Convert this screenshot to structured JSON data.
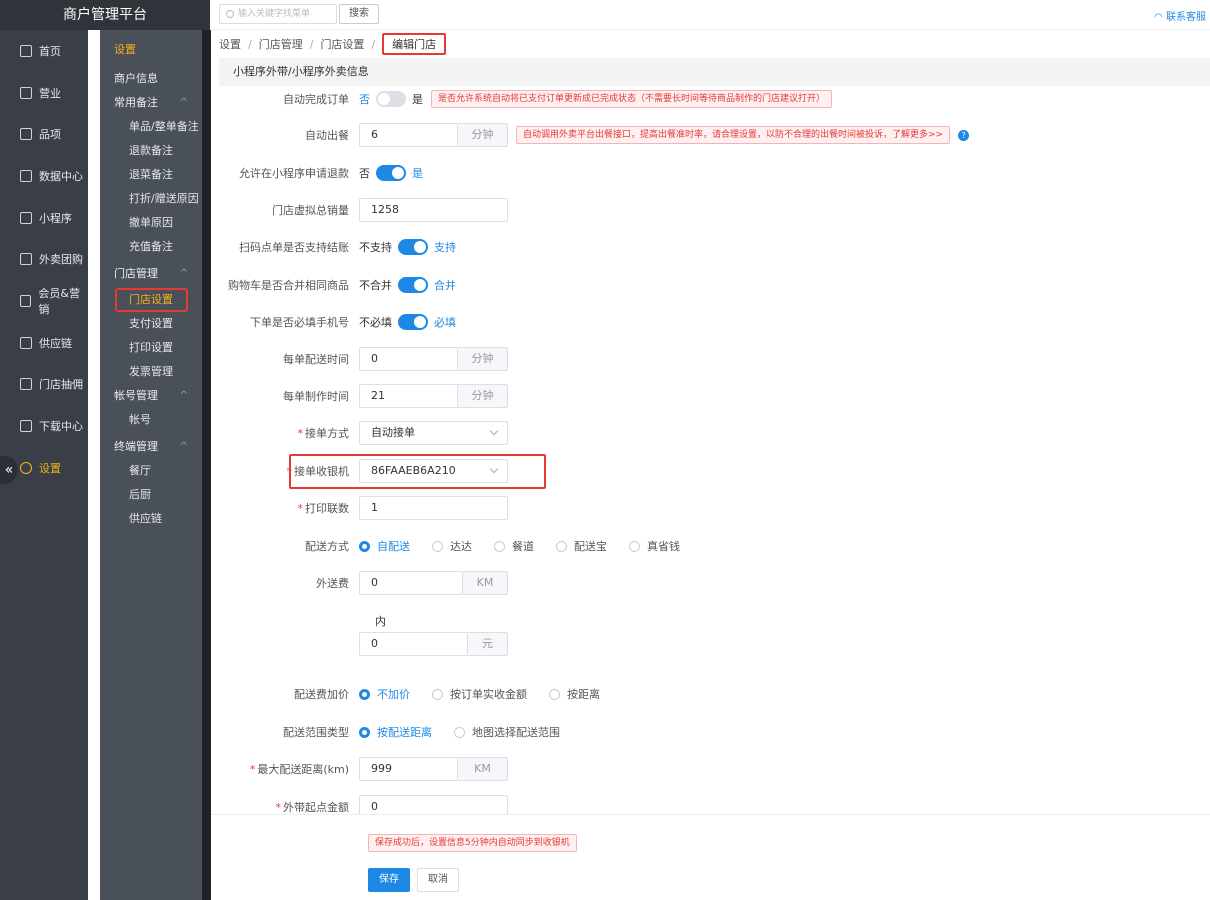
{
  "brand": "商户管理平台",
  "nav": [
    {
      "label": "首页",
      "icon": "home-icon"
    },
    {
      "label": "营业",
      "icon": "calendar-icon"
    },
    {
      "label": "品项",
      "icon": "bag-icon"
    },
    {
      "label": "数据中心",
      "icon": "share-icon"
    },
    {
      "label": "小程序",
      "icon": "phone-icon"
    },
    {
      "label": "外卖团购",
      "icon": "bike-icon"
    },
    {
      "label": "会员&营销",
      "icon": "user-icon"
    },
    {
      "label": "供应链",
      "icon": "truck-icon"
    },
    {
      "label": "门店抽佣",
      "icon": "database-icon"
    },
    {
      "label": "下载中心",
      "icon": "download-icon"
    },
    {
      "label": "设置",
      "icon": "gear-icon"
    }
  ],
  "collapse_glyph": "«",
  "subnav": {
    "title": "设置",
    "shop_info": "商户信息",
    "groups": [
      {
        "label": "常用备注",
        "items": [
          "单品/整单备注",
          "退款备注",
          "退菜备注",
          "打折/赠送原因",
          "撤单原因",
          "充值备注"
        ]
      },
      {
        "label": "门店管理",
        "items": [
          "门店设置",
          "支付设置",
          "打印设置",
          "发票管理"
        ]
      },
      {
        "label": "帐号管理",
        "items": [
          "帐号"
        ]
      },
      {
        "label": "终端管理",
        "items": [
          "餐厅",
          "后厨",
          "供应链"
        ]
      }
    ],
    "caret": "^"
  },
  "topbar": {
    "search_placeholder": "输入关键字找菜单",
    "search_button": "搜索",
    "contact": "联系客服"
  },
  "breadcrumb": [
    "设置",
    "门店管理",
    "门店设置",
    "编辑门店"
  ],
  "section_title": "小程序外带/小程序外卖信息",
  "form": {
    "auto_complete": {
      "label": "自动完成订单",
      "off": "否",
      "on": "是",
      "tip": "是否允许系统自动将已支付订单更新成已完成状态（不需要长时间等待商品制作的门店建议打开）"
    },
    "auto_out": {
      "label": "自动出餐",
      "value": "6",
      "unit": "分钟",
      "tip": "自动调用外卖平台出餐接口，提高出餐准时率，请合理设置，以防不合理的出餐时间被投诉，了解更多>>"
    },
    "allow_refund": {
      "label": "允许在小程序申请退款",
      "off": "否",
      "on": "是"
    },
    "virtual_sales": {
      "label": "门店虚拟总销量",
      "value": "1258"
    },
    "scan_checkout": {
      "label": "扫码点单是否支持结账",
      "off": "不支持",
      "on": "支持"
    },
    "cart_merge": {
      "label": "购物车是否合并相同商品",
      "off": "不合并",
      "on": "合并"
    },
    "phone_required": {
      "label": "下单是否必填手机号",
      "off": "不必填",
      "on": "必填"
    },
    "delivery_time": {
      "label": "每单配送时间",
      "value": "0",
      "unit": "分钟"
    },
    "make_time": {
      "label": "每单制作时间",
      "value": "21",
      "unit": "分钟"
    },
    "accept_mode": {
      "label": "接单方式",
      "value": "自动接单"
    },
    "accept_cashier": {
      "label": "接单收银机",
      "value": "86FAAEB6A210"
    },
    "print_copies": {
      "label": "打印联数",
      "value": "1"
    },
    "delivery_method": {
      "label": "配送方式",
      "options": [
        "自配送",
        "达达",
        "餐道",
        "配送宝",
        "真省钱"
      ],
      "selected": 0
    },
    "delivery_fee": {
      "label": "外送费",
      "value": "0",
      "unit": "KM",
      "inner": "内",
      "amount": "0",
      "amount_unit": "元"
    },
    "fee_markup": {
      "label": "配送费加价",
      "options": [
        "不加价",
        "按订单实收金额",
        "按距离"
      ],
      "selected": 0
    },
    "range_type": {
      "label": "配送范围类型",
      "options": [
        "按配送距离",
        "地图选择配送范围"
      ],
      "selected": 0
    },
    "max_distance": {
      "label": "最大配送距离(km)",
      "value": "999",
      "unit": "KM"
    },
    "min_amount": {
      "label": "外带起点金额",
      "value": "0"
    }
  },
  "required_mark": "*",
  "help_glyph": "?",
  "footer": {
    "tip": "保存成功后，设置信息5分钟内自动同步到收银机",
    "save": "保存",
    "cancel": "取消"
  },
  "colors": {
    "primary": "#1e88e5",
    "accent": "#f5b21b",
    "danger": "#e53935",
    "nav_bg": "#3a3f47"
  }
}
